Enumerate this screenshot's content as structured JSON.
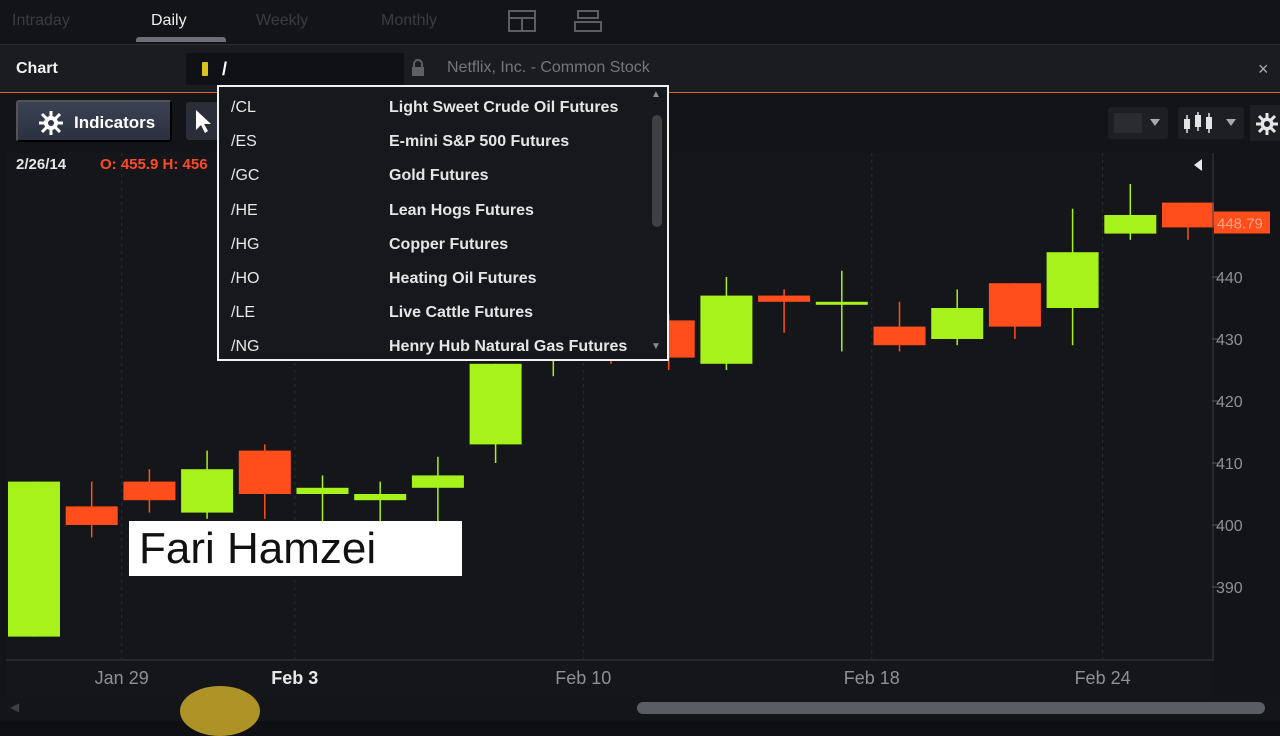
{
  "tabs": [
    {
      "label": "Intraday",
      "active": false
    },
    {
      "label": "Daily",
      "active": true
    },
    {
      "label": "Weekly",
      "active": false
    },
    {
      "label": "Monthly",
      "active": false
    }
  ],
  "header": {
    "title": "Chart",
    "symbol_value": "/",
    "company": "Netflix, Inc. - Common Stock",
    "close_glyph": "×"
  },
  "toolbar": {
    "indicators_label": "Indicators"
  },
  "readout": {
    "date": "2/26/14",
    "ohlc": "O: 455.9  H: 456"
  },
  "symbol_list": [
    {
      "code": "/CL",
      "name": "Light Sweet Crude Oil Futures"
    },
    {
      "code": "/ES",
      "name": "E-mini S&P 500 Futures"
    },
    {
      "code": "/GC",
      "name": "Gold Futures"
    },
    {
      "code": "/HE",
      "name": "Lean Hogs Futures"
    },
    {
      "code": "/HG",
      "name": "Copper Futures"
    },
    {
      "code": "/HO",
      "name": "Heating Oil Futures"
    },
    {
      "code": "/LE",
      "name": "Live Cattle Futures"
    },
    {
      "code": "/NG",
      "name": "Henry Hub Natural Gas Futures"
    }
  ],
  "watermark": "Fari Hamzei",
  "colors": {
    "up": "#a6f21a",
    "down": "#ff4e1c",
    "accent": "#d9692a"
  },
  "chart_data": {
    "type": "candlestick",
    "last_price": "448.79",
    "y_ticks": [
      390,
      400,
      410,
      420,
      430,
      440
    ],
    "x_ticks": [
      {
        "label": "Jan 29",
        "bold": false,
        "index": 1
      },
      {
        "label": "Feb 3",
        "bold": true,
        "index": 4
      },
      {
        "label": "Feb 10",
        "bold": false,
        "index": 9
      },
      {
        "label": "Feb 18",
        "bold": false,
        "index": 14
      },
      {
        "label": "Feb 24",
        "bold": false,
        "index": 18
      }
    ],
    "candles": [
      {
        "o": 382,
        "h": 407,
        "l": 382,
        "c": 407
      },
      {
        "o": 403,
        "h": 407,
        "l": 398,
        "c": 400
      },
      {
        "o": 407,
        "h": 409,
        "l": 402,
        "c": 404
      },
      {
        "o": 402,
        "h": 412,
        "l": 401,
        "c": 409
      },
      {
        "o": 412,
        "h": 413,
        "l": 401,
        "c": 405
      },
      {
        "o": 405,
        "h": 408,
        "l": 400,
        "c": 406
      },
      {
        "o": 404,
        "h": 407,
        "l": 400,
        "c": 405
      },
      {
        "o": 406,
        "h": 411,
        "l": 400,
        "c": 408
      },
      {
        "o": 413,
        "h": 426,
        "l": 410,
        "c": 426
      },
      {
        "o": 432,
        "h": 434,
        "l": 424,
        "c": 433
      },
      {
        "o": 433,
        "h": 435,
        "l": 426,
        "c": 432
      },
      {
        "o": 433,
        "h": 434,
        "l": 425,
        "c": 427
      },
      {
        "o": 426,
        "h": 440,
        "l": 425,
        "c": 437
      },
      {
        "o": 437,
        "h": 438,
        "l": 431,
        "c": 436
      },
      {
        "o": 436,
        "h": 441,
        "l": 428,
        "c": 436
      },
      {
        "o": 432,
        "h": 436,
        "l": 428,
        "c": 429
      },
      {
        "o": 430,
        "h": 438,
        "l": 429,
        "c": 435
      },
      {
        "o": 439,
        "h": 439,
        "l": 430,
        "c": 432
      },
      {
        "o": 435,
        "h": 451,
        "l": 429,
        "c": 444
      },
      {
        "o": 447,
        "h": 455,
        "l": 446,
        "c": 450
      },
      {
        "o": 452,
        "h": 452,
        "l": 446,
        "c": 448
      }
    ]
  }
}
